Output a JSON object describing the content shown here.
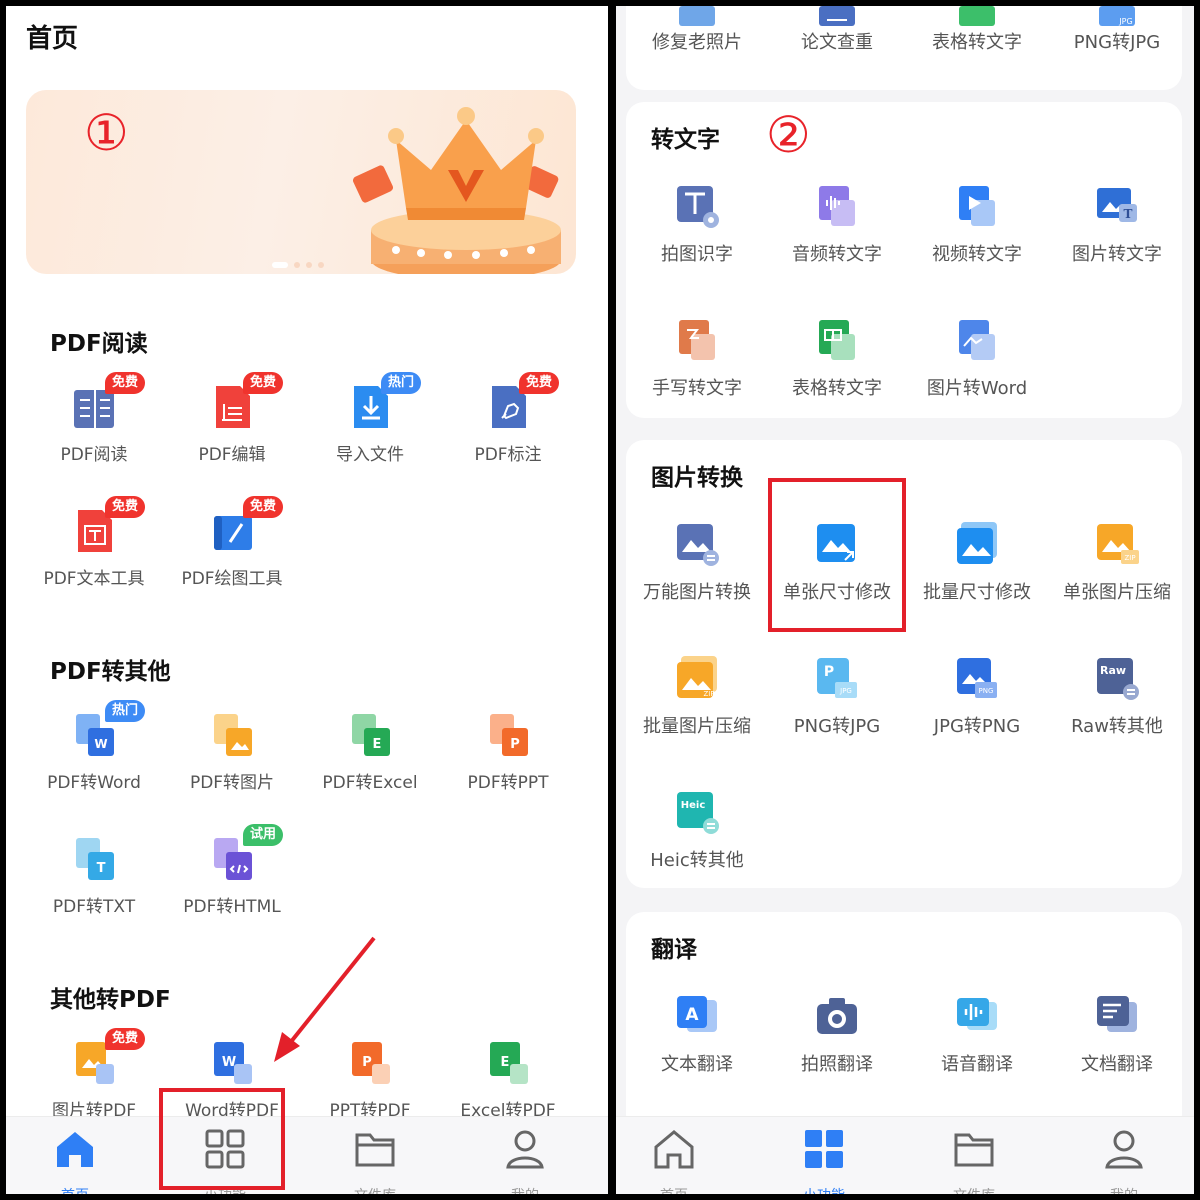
{
  "left": {
    "title": "首页",
    "banner_marker": "①",
    "sections": [
      {
        "title": "PDF阅读",
        "items": [
          {
            "label": "PDF阅读",
            "badge": "免费"
          },
          {
            "label": "PDF编辑",
            "badge": "免费"
          },
          {
            "label": "导入文件",
            "badge": "热门"
          },
          {
            "label": "PDF标注",
            "badge": "免费"
          },
          {
            "label": "PDF文本工具",
            "badge": "免费"
          },
          {
            "label": "PDF绘图工具",
            "badge": "免费"
          }
        ]
      },
      {
        "title": "PDF转其他",
        "items": [
          {
            "label": "PDF转Word",
            "badge": "热门"
          },
          {
            "label": "PDF转图片"
          },
          {
            "label": "PDF转Excel"
          },
          {
            "label": "PDF转PPT"
          },
          {
            "label": "PDF转TXT"
          },
          {
            "label": "PDF转HTML",
            "badge": "试用"
          }
        ]
      },
      {
        "title": "其他转PDF",
        "items": [
          {
            "label": "图片转PDF",
            "badge": "免费"
          },
          {
            "label": "Word转PDF"
          },
          {
            "label": "PPT转PDF"
          },
          {
            "label": "Excel转PDF"
          }
        ]
      }
    ],
    "tabs": [
      "首页",
      "小功能",
      "文件库",
      "我的"
    ]
  },
  "right": {
    "top_row": [
      "修复老照片",
      "论文查重",
      "表格转文字",
      "PNG转JPG"
    ],
    "marker": "②",
    "sections": [
      {
        "title": "转文字",
        "items": [
          "拍图识字",
          "音频转文字",
          "视频转文字",
          "图片转文字",
          "手写转文字",
          "表格转文字",
          "图片转Word"
        ]
      },
      {
        "title": "图片转换",
        "items": [
          "万能图片转换",
          "单张尺寸修改",
          "批量尺寸修改",
          "单张图片压缩",
          "批量图片压缩",
          "PNG转JPG",
          "JPG转PNG",
          "Raw转其他",
          "Heic转其他"
        ]
      },
      {
        "title": "翻译",
        "items": [
          "文本翻译",
          "拍照翻译",
          "语音翻译",
          "文档翻译"
        ]
      }
    ],
    "tabs": [
      "首页",
      "小功能",
      "文件库",
      "我的"
    ]
  },
  "icon_text": {
    "jpg": "JPG",
    "png": "PNG",
    "zip": "ZIP",
    "raw": "Raw",
    "heic": "Heic",
    "p": "P",
    "e": "E",
    "w": "W",
    "t": "T",
    "a": "A"
  },
  "colors": {
    "accent_blue": "#2f7ff5",
    "highlight_red": "#e3202a",
    "badge_red": "#f0332d",
    "badge_blue": "#3d8bf5",
    "badge_green": "#3bbf69"
  }
}
